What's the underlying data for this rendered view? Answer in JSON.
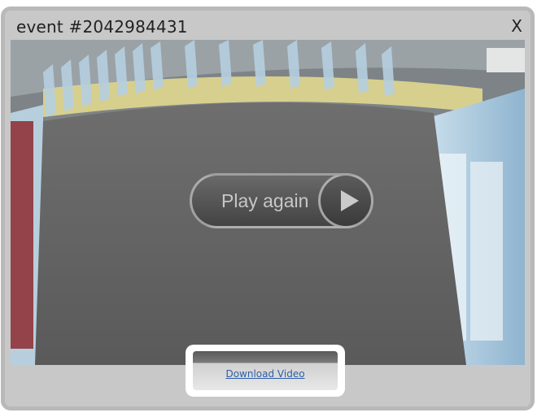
{
  "dialog": {
    "title": "event #2042984431",
    "close_label": "X"
  },
  "player": {
    "play_again_label": "Play again"
  },
  "download": {
    "label": "Download Video"
  },
  "colors": {
    "dialog_bg": "#c8c8c8",
    "link": "#2e5ea8"
  },
  "icons": [
    "close-icon",
    "play-icon"
  ]
}
